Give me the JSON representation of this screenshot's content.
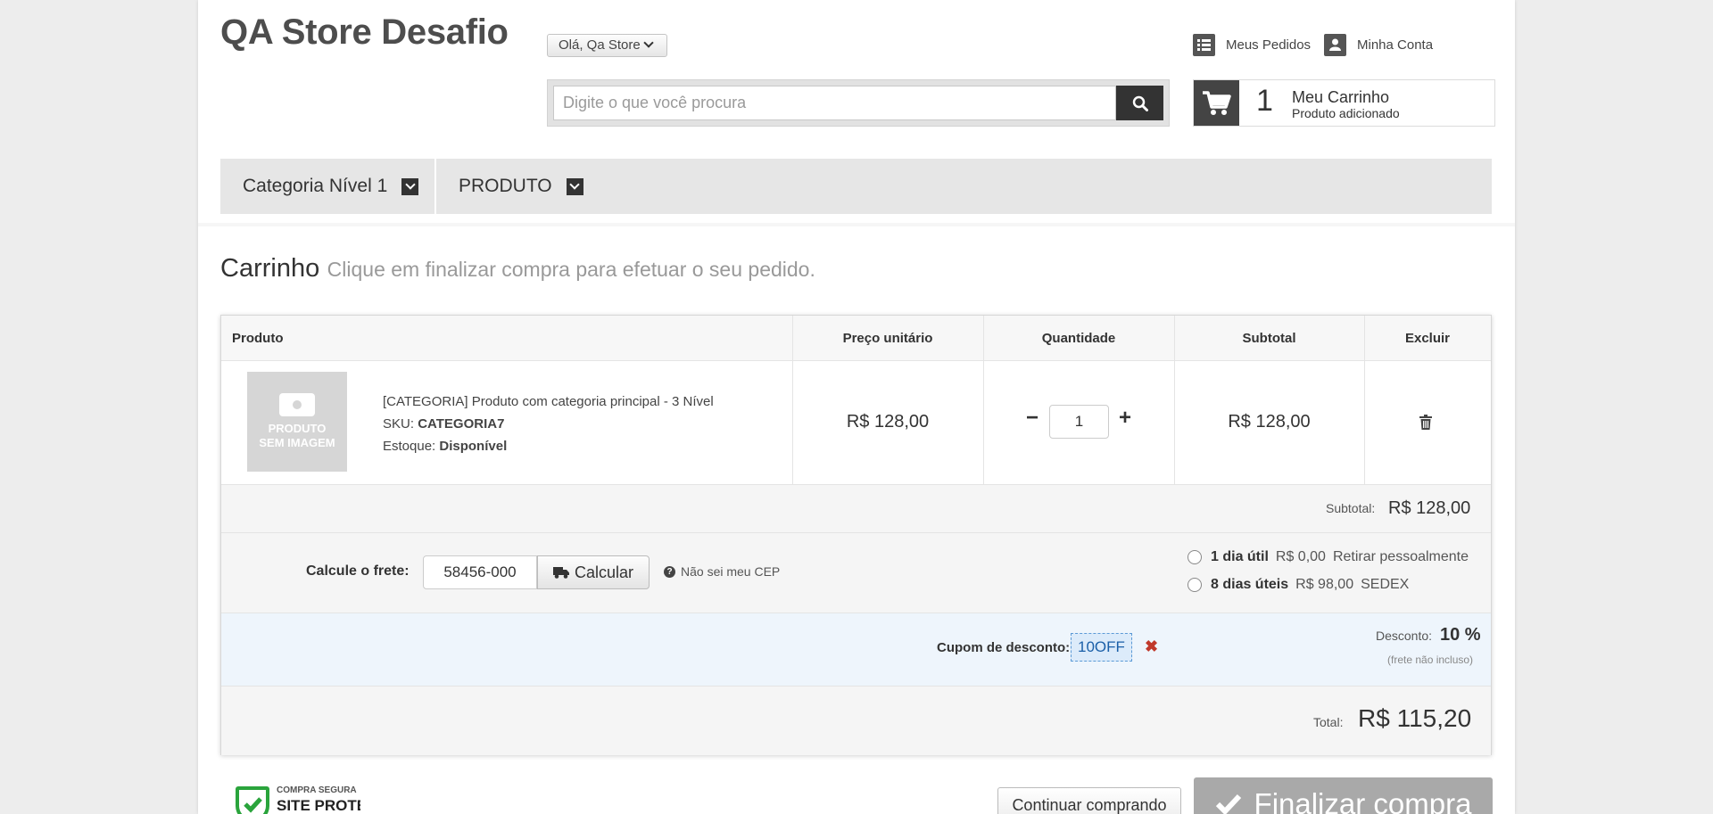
{
  "header": {
    "logo": "QA Store Desafio",
    "greeting": "Olá, Qa Store",
    "my_orders": "Meus Pedidos",
    "my_account": "Minha Conta",
    "search_placeholder": "Digite o que você procura",
    "cart": {
      "count": "1",
      "title": "Meu Carrinho",
      "subtitle": "Produto adicionado"
    }
  },
  "nav": {
    "items": [
      {
        "label": "Categoria Nível 1"
      },
      {
        "label": "PRODUTO"
      }
    ]
  },
  "page": {
    "title": "Carrinho",
    "subtitle": "Clique em finalizar compra para efetuar o seu pedido."
  },
  "table": {
    "headers": {
      "product": "Produto",
      "unit_price": "Preço unitário",
      "quantity": "Quantidade",
      "subtotal": "Subtotal",
      "remove": "Excluir"
    },
    "rows": [
      {
        "image_text_1": "PRODUTO",
        "image_text_2": "SEM IMAGEM",
        "name": "[CATEGORIA] Produto com categoria principal - 3 Nível",
        "sku_label": "SKU:",
        "sku": "CATEGORIA7",
        "stock_label": "Estoque:",
        "stock": "Disponível",
        "unit_price": "R$ 128,00",
        "quantity": "1",
        "subtotal": "R$ 128,00"
      }
    ]
  },
  "summary": {
    "subtotal_label": "Subtotal:",
    "subtotal_value": "R$ 128,00",
    "shipping_label": "Calcule o frete:",
    "cep_value": "58456-000",
    "calc_button": "Calcular",
    "unknown_cep": "Não sei meu CEP",
    "shipping_options": [
      {
        "days": "1 dia útil",
        "price": "R$ 0,00",
        "method": "Retirar pessoalmente"
      },
      {
        "days": "8 dias úteis",
        "price": "R$ 98,00",
        "method": "SEDEX"
      }
    ],
    "coupon_label": "Cupom de desconto:",
    "coupon_code": "10OFF",
    "discount_label": "Desconto:",
    "discount_value": "10 %",
    "discount_note": "(frete não incluso)",
    "total_label": "Total:",
    "total_value": "R$ 115,20"
  },
  "actions": {
    "continue": "Continuar comprando",
    "finalize": "Finalizar compra"
  },
  "seal": {
    "line1": "COMPRA SEGURA",
    "line2": "SITE PROTEGIDO"
  }
}
